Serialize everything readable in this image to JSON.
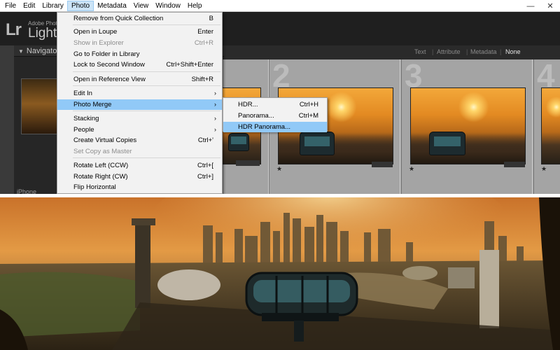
{
  "menubar": {
    "items": [
      "File",
      "Edit",
      "Library",
      "Photo",
      "Metadata",
      "View",
      "Window",
      "Help"
    ],
    "active": "Photo",
    "window_minimize": "—",
    "window_close": "✕"
  },
  "app": {
    "logo": "Lr",
    "brand_line": "Adobe Photo",
    "brand_big": "Lightro"
  },
  "left_panel": {
    "navigator_label": "Navigato",
    "device_label": "iPhone"
  },
  "toolbar": {
    "filters": [
      "Text",
      "Attribute",
      "Metadata",
      "None"
    ],
    "active_filter": "None"
  },
  "filmstrip": {
    "cell_numbers": [
      "2",
      "3",
      "4"
    ],
    "star": "★"
  },
  "photo_menu": {
    "items": [
      {
        "label": "Remove from Quick Collection",
        "shortcut": "B"
      },
      {
        "label": "Open in Loupe",
        "shortcut": "Enter"
      },
      {
        "label": "Show in Explorer",
        "shortcut": "Ctrl+R",
        "disabled": true
      },
      {
        "label": "Go to Folder in Library",
        "shortcut": ""
      },
      {
        "label": "Lock to Second Window",
        "shortcut": "Ctrl+Shift+Enter"
      },
      {
        "label": "Open in Reference View",
        "shortcut": "Shift+R"
      },
      {
        "label": "Edit In",
        "submenu": true
      },
      {
        "label": "Photo Merge",
        "submenu": true,
        "highlight": true
      },
      {
        "label": "Stacking",
        "submenu": true
      },
      {
        "label": "People",
        "submenu": true
      },
      {
        "label": "Create Virtual Copies",
        "shortcut": "Ctrl+'"
      },
      {
        "label": "Set Copy as Master",
        "shortcut": "",
        "disabled": true
      },
      {
        "label": "Rotate Left (CCW)",
        "shortcut": "Ctrl+["
      },
      {
        "label": "Rotate Right (CW)",
        "shortcut": "Ctrl+]"
      },
      {
        "label": "Flip Horizontal",
        "shortcut": ""
      }
    ],
    "submenu_arrow": "›"
  },
  "photo_merge_submenu": {
    "items": [
      {
        "label": "HDR...",
        "shortcut": "Ctrl+H"
      },
      {
        "label": "Panorama...",
        "shortcut": "Ctrl+M"
      },
      {
        "label": "HDR Panorama...",
        "shortcut": "",
        "highlight": true
      }
    ]
  },
  "colors": {
    "menu_highlight": "#91c9f7",
    "menubar_active": "#cce4f7",
    "lightroom_dark": "#1f1f1f",
    "filmstrip_gray": "#9d9d9d",
    "sunset_orange": "#e38a22"
  }
}
